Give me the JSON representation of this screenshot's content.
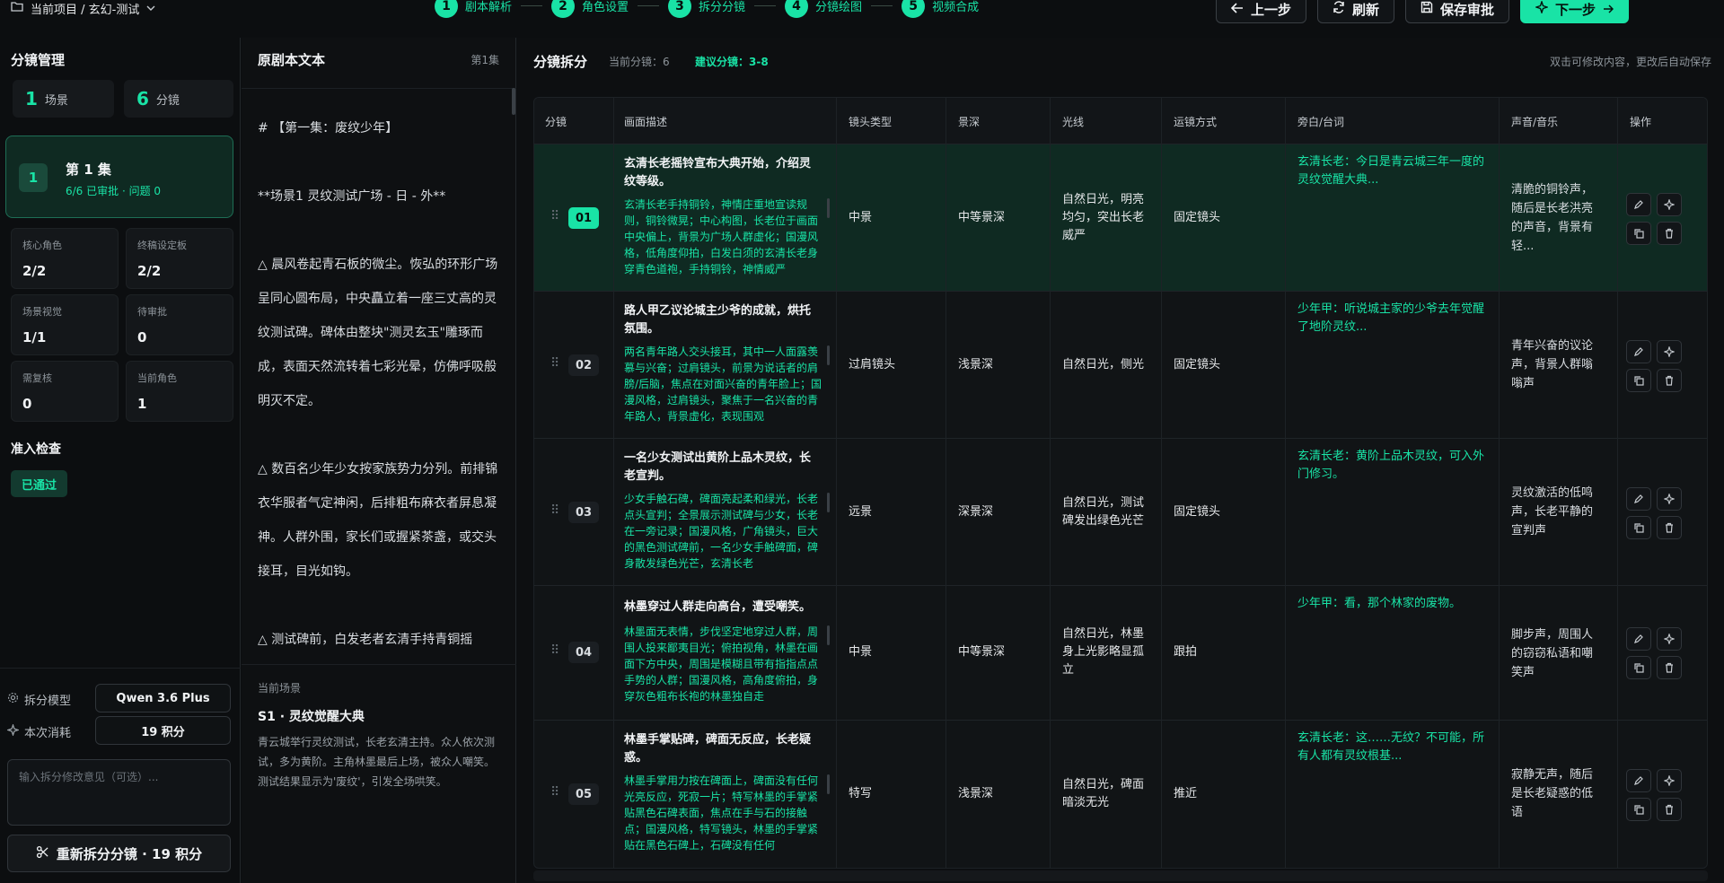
{
  "header": {
    "project": "当前项目 / 玄幻-测试",
    "steps": [
      {
        "num": "1",
        "label": "剧本解析"
      },
      {
        "num": "2",
        "label": "角色设置"
      },
      {
        "num": "3",
        "label": "拆分分镜"
      },
      {
        "num": "4",
        "label": "分镜绘图"
      },
      {
        "num": "5",
        "label": "视频合成"
      }
    ],
    "buttons": {
      "prev": "上一步",
      "refresh": "刷新",
      "save": "保存审批",
      "next": "下一步"
    }
  },
  "left": {
    "title": "分镜管理",
    "scenes": {
      "count": "1",
      "label": "场景"
    },
    "shots": {
      "count": "6",
      "label": "分镜"
    },
    "episode": {
      "num": "1",
      "title": "第 1 集",
      "sub": "6/6 已审批 · 问题 0"
    },
    "stats": [
      {
        "label": "核心角色",
        "value": "2/2"
      },
      {
        "label": "终稿设定板",
        "value": "2/2"
      },
      {
        "label": "场景视觉",
        "value": "1/1"
      },
      {
        "label": "待审批",
        "value": "0"
      },
      {
        "label": "需复核",
        "value": "0"
      },
      {
        "label": "当前角色",
        "value": "1"
      }
    ],
    "check_title": "准入检查",
    "check_badge": "已通过",
    "model_label": "拆分模型",
    "model_value": "Qwen 3.6 Plus",
    "cost_label": "本次消耗",
    "cost_value": "19 积分",
    "input_placeholder": "输入拆分修改意见（可选）...",
    "regen_label": "重新拆分分镜 · 19 积分"
  },
  "script": {
    "title": "原剧本文本",
    "episode": "第1集",
    "paragraphs": [
      "# 【第一集：废纹少年】",
      "**场景1 灵纹测试广场 - 日 - 外**",
      "△ 晨风卷起青石板的微尘。恢弘的环形广场呈同心圆布局，中央矗立着一座三丈高的灵纹测试碑。碑体由整块\"测灵玄玉\"雕琢而成，表面天然流转着七彩光晕，仿佛呼吸般明灭不定。",
      "△ 数百名少年少女按家族势力分列。前排锦衣华服者气定神闲，后排粗布麻衣者屏息凝神。人群外围，家长们或握紧茶盏，或交头接耳，目光如钩。",
      "△ 测试碑前，白发老者玄清手持青铜摇"
    ],
    "current_label": "当前场景",
    "current_title": "S1 · 灵纹觉醒大典",
    "current_desc": "青云城举行灵纹测试，长老玄清主持。众人依次测试，多为黄阶。主角林墨最后上场，被众人嘲笑。测试结果显示为'废纹'，引发全场哄笑。"
  },
  "board": {
    "title": "分镜拆分",
    "current": "当前分镜：6",
    "suggest": "建议分镜：3-8",
    "hint": "双击可修改内容，更改后自动保存",
    "columns": [
      "分镜",
      "画面描述",
      "镜头类型",
      "景深",
      "光线",
      "运镜方式",
      "旁白/台词",
      "声音/音乐",
      "操作"
    ],
    "rows": [
      {
        "idx": "01",
        "title": "玄清长老摇铃宣布大典开始，介绍灵纹等级。",
        "detail": "玄清长老手持铜铃，神情庄重地宣读规则，铜铃微晃；中心构图，长老位于画面中央偏上，背景为广场人群虚化；国漫风格，低角度仰拍，白发白须的玄清长老身穿青色道袍，手持铜铃，神情威严",
        "shot": "中景",
        "depth": "中等景深",
        "light": "自然日光，明亮均匀，突出长老威严",
        "move": "固定镜头",
        "line": "玄清长老：今日是青云城三年一度的灵纹觉醒大典...",
        "sound": "清脆的铜铃声，随后是长老洪亮的声音，背景有轻..."
      },
      {
        "idx": "02",
        "title": "路人甲乙议论城主少爷的成就，烘托氛围。",
        "detail": "两名青年路人交头接耳，其中一人面露羡慕与兴奋；过肩镜头，前景为说话者的肩膀/后脑，焦点在对面兴奋的青年脸上；国漫风格，过肩镜头，聚焦于一名兴奋的青年路人，背景虚化，表现围观",
        "shot": "过肩镜头",
        "depth": "浅景深",
        "light": "自然日光，侧光",
        "move": "固定镜头",
        "line": "少年甲：听说城主家的少爷去年觉醒了地阶灵纹...",
        "sound": "青年兴奋的议论声，背景人群嗡嗡声"
      },
      {
        "idx": "03",
        "title": "一名少女测试出黄阶上品木灵纹，长老宣判。",
        "detail": "少女手触石碑，碑面亮起柔和绿光，长老点头宣判；全景展示测试碑与少女，长老在一旁记录；国漫风格，广角镜头，巨大的黑色测试碑前，一名少女手触碑面，碑身散发绿色光芒，玄清长老",
        "shot": "远景",
        "depth": "深景深",
        "light": "自然日光，测试碑发出绿色光芒",
        "move": "固定镜头",
        "line": "玄清长老：黄阶上品木灵纹，可入外门修习。",
        "sound": "灵纹激活的低鸣声，长老平静的宣判声"
      },
      {
        "idx": "04",
        "title": "林墨穿过人群走向高台，遭受嘲笑。",
        "detail": "林墨面无表情，步伐坚定地穿过人群，周围人投来鄙夷目光；俯拍视角，林墨在画面下方中央，周围是模糊且带有指指点点手势的人群；国漫风格，高角度俯拍，身穿灰色粗布长袍的林墨独自走",
        "shot": "中景",
        "depth": "中等景深",
        "light": "自然日光，林墨身上光影略显孤立",
        "move": "跟拍",
        "line": "少年甲：看，那个林家的废物。",
        "sound": "脚步声，周围人的窃窃私语和嘲笑声"
      },
      {
        "idx": "05",
        "title": "林墨手掌贴碑，碑面无反应，长老疑惑。",
        "detail": "林墨手掌用力按在碑面上，碑面没有任何光亮反应，死寂一片；特写林墨的手掌紧贴黑色石碑表面，焦点在手与石的接触点；国漫风格，特写镜头，林墨的手掌紧贴在黑色石碑上，石碑没有任何",
        "shot": "特写",
        "depth": "浅景深",
        "light": "自然日光，碑面暗淡无光",
        "move": "推近",
        "line": "玄清长老：这……无纹？不可能，所有人都有灵纹根基...",
        "sound": "寂静无声，随后是长老疑惑的低语"
      }
    ]
  }
}
